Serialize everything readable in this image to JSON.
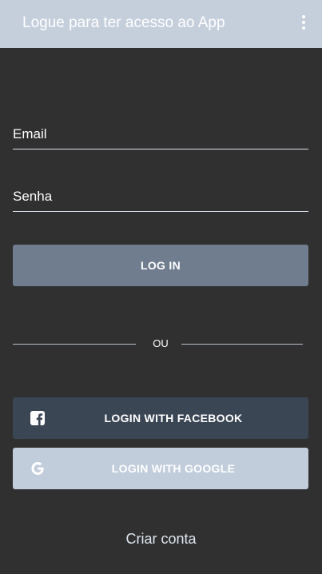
{
  "appbar": {
    "title": "Logue para ter acesso ao App",
    "menu_icon": "more-vert-icon"
  },
  "form": {
    "email_placeholder": "Email",
    "password_placeholder": "Senha",
    "login_label": "LOG IN"
  },
  "divider": {
    "text": "OU"
  },
  "social": {
    "facebook_label": "LOGIN WITH FACEBOOK",
    "facebook_icon": "facebook-icon",
    "google_label": "LOGIN WITH GOOGLE",
    "google_icon": "google-icon"
  },
  "footer": {
    "create_account_label": "Criar conta"
  },
  "colors": {
    "appbar_bg": "#c5cfdc",
    "background": "#303030",
    "login_button": "#707d8e",
    "facebook_button": "#3b4655",
    "google_button": "#c2cddb"
  }
}
